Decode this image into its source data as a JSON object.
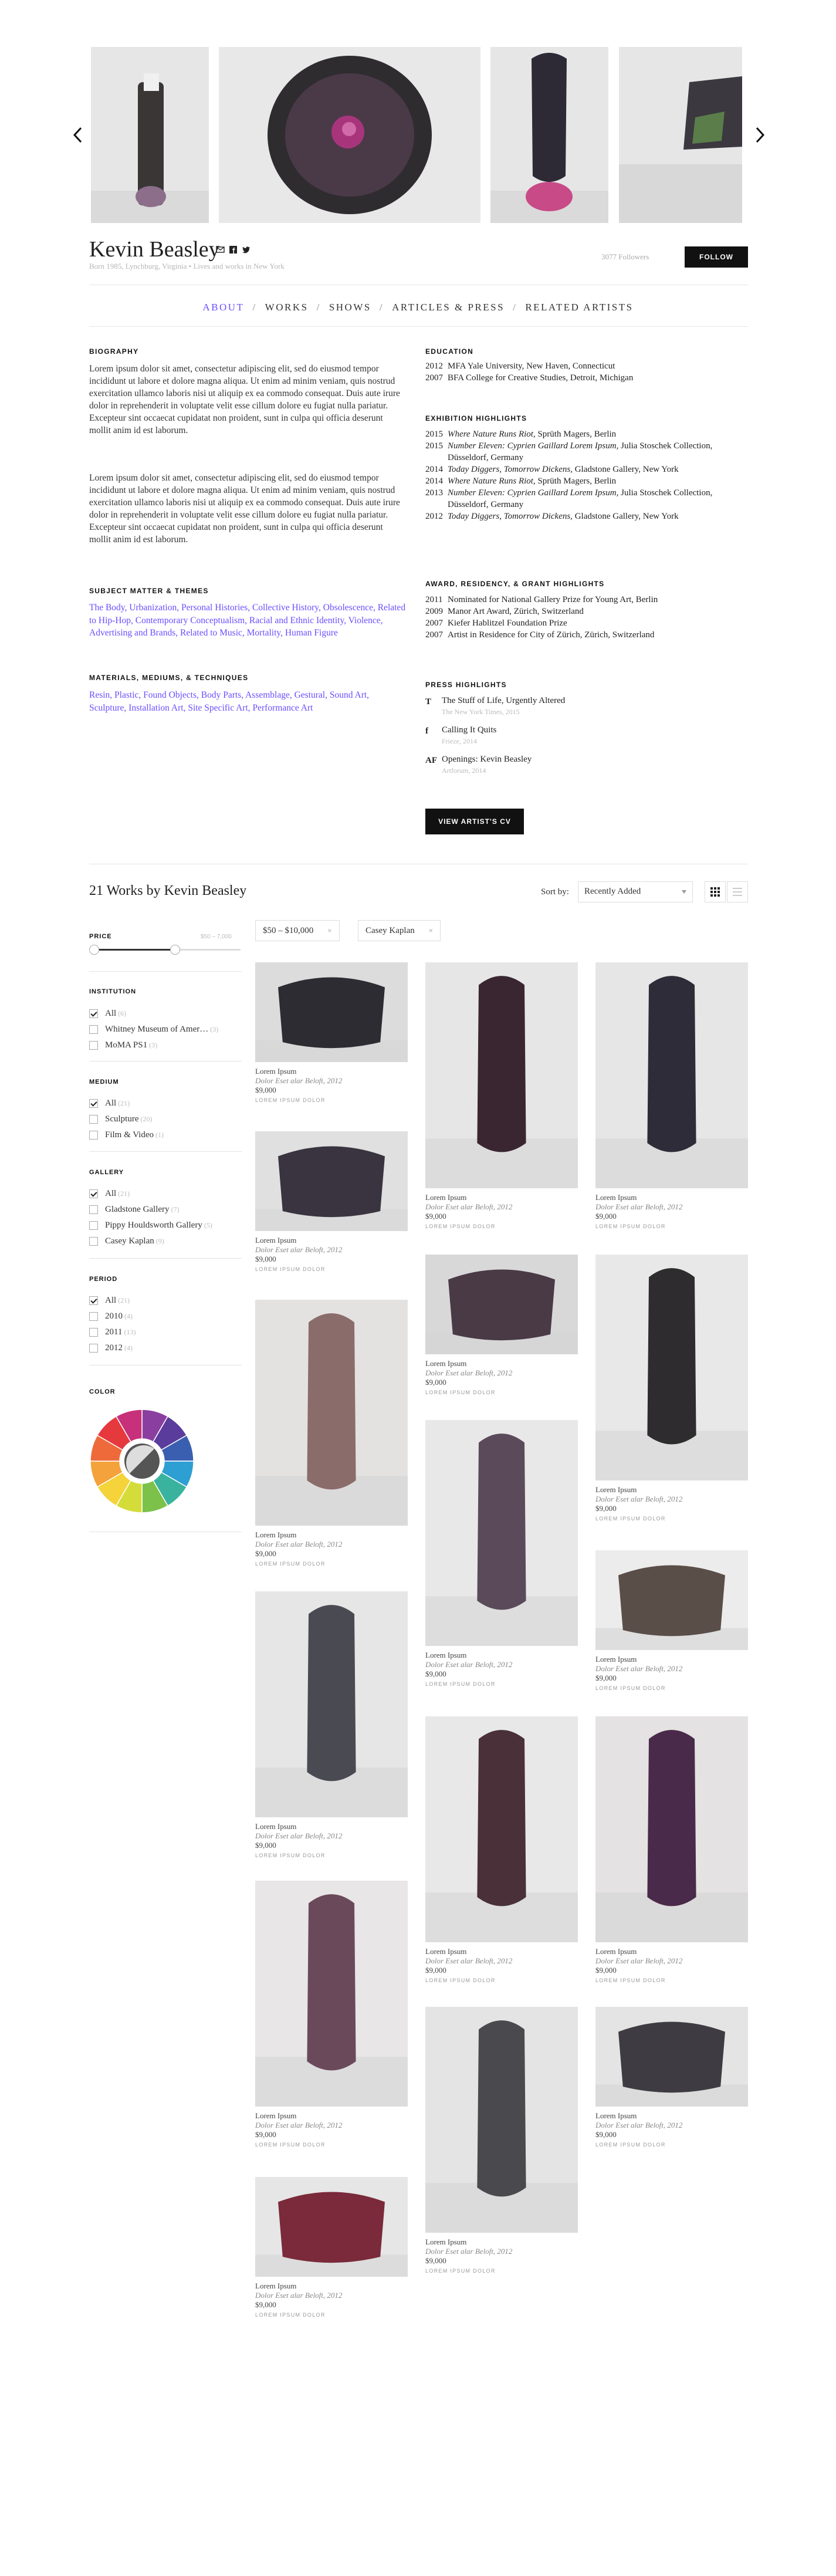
{
  "carousel": {
    "prev_icon": "chevron-left-icon",
    "next_icon": "chevron-right-icon"
  },
  "artist": {
    "name": "Kevin Beasley",
    "bio_line": "Born 1985, Lynchburg, Virginia • Lives and works in New York",
    "followers": "3077 Followers",
    "follow_label": "FOLLOW",
    "social_icons": [
      "email-icon",
      "facebook-icon",
      "twitter-icon"
    ]
  },
  "tabs": [
    "ABOUT",
    "WORKS",
    "SHOWS",
    "ARTICLES & PRESS",
    "RELATED ARTISTS"
  ],
  "about": {
    "biography_heading": "BIOGRAPHY",
    "bio_p1": "Lorem ipsum dolor sit amet, consectetur adipiscing elit, sed do eiusmod tempor incididunt ut labore et dolore magna aliqua. Ut enim ad minim veniam, quis nostrud exercitation ullamco laboris nisi ut aliquip ex ea commodo consequat. Duis aute irure dolor in reprehenderit in voluptate velit esse cillum dolore eu fugiat nulla pariatur. Excepteur sint occaecat cupidatat non proident, sunt in culpa qui officia deserunt mollit anim id est laborum.",
    "bio_p2": "Lorem ipsum dolor sit amet, consectetur adipiscing elit, sed do eiusmod tempor incididunt ut labore et dolore magna aliqua. Ut enim ad minim veniam, quis nostrud exercitation ullamco laboris nisi ut aliquip ex ea commodo consequat. Duis aute irure dolor in reprehenderit in voluptate velit esse cillum dolore eu fugiat nulla pariatur. Excepteur sint occaecat cupidatat non proident, sunt in culpa qui officia deserunt mollit anim id est laborum.",
    "subject_heading": "SUBJECT MATTER & THEMES",
    "subjects": "The Body, Urbanization, Personal Histories, Collective History, Obsolescence, Related to Hip-Hop, Contemporary Conceptualism, Racial and Ethnic Identity, Violence, Advertising and Brands, Related to Music, Mortality, Human Figure",
    "materials_heading": "MATERIALS, MEDIUMS, & TECHNIQUES",
    "materials": "Resin, Plastic, Found Objects, Body Parts, Assemblage, Gestural, Sound Art, Sculpture, Installation Art, Site Specific Art, Performance Art",
    "education_heading": "EDUCATION",
    "education": [
      {
        "year": "2012",
        "text": "MFA Yale University, New Haven, Connecticut"
      },
      {
        "year": "2007",
        "text": "BFA College for Creative Studies, Detroit, Michigan"
      }
    ],
    "exhibition_heading": "EXHIBITION HIGHLIGHTS",
    "exhibitions": [
      {
        "year": "2015",
        "title": "Where Nature Runs Riot,",
        "rest": " Sprüth Magers, Berlin"
      },
      {
        "year": "2015",
        "title": "Number Eleven: Cyprien Gaillard Lorem Ipsum,",
        "rest": " Julia Stoschek Collection, Düsseldorf, Germany"
      },
      {
        "year": "2014",
        "title": "Today Diggers, Tomorrow Dickens,",
        "rest": " Gladstone Gallery, New York"
      },
      {
        "year": "2014",
        "title": "Where Nature Runs Riot,",
        "rest": " Sprüth Magers, Berlin"
      },
      {
        "year": "2013",
        "title": "Number Eleven: Cyprien Gaillard Lorem Ipsum,",
        "rest": " Julia Stoschek Collection, Düsseldorf, Germany"
      },
      {
        "year": "2012",
        "title": "Today Diggers, Tomorrow Dickens,",
        "rest": " Gladstone Gallery, New York"
      }
    ],
    "award_heading": "AWARD, RESIDENCY, & GRANT HIGHLIGHTS",
    "awards": [
      {
        "year": "2011",
        "text": "Nominated for National Gallery Prize for Young Art, Berlin"
      },
      {
        "year": "2009",
        "text": "Manor Art Award, Zürich, Switzerland"
      },
      {
        "year": "2007",
        "text": "Kiefer Hablitzel Foundation Prize"
      },
      {
        "year": "2007",
        "text": "Artist in Residence for City of Zürich, Zürich, Switzerland"
      }
    ],
    "press_heading": "PRESS HIGHLIGHTS",
    "press": [
      {
        "icon": "T",
        "title": "The Stuff of Life, Urgently Altered",
        "source": "The New York Times, 2015"
      },
      {
        "icon": "f",
        "title": "Calling It Quits",
        "source": "Frieze, 2014"
      },
      {
        "icon": "AF",
        "title": "Openings: Kevin Beasley",
        "source": "Artforum, 2014"
      }
    ],
    "cv_label": "VIEW ARTIST'S CV"
  },
  "works_header": {
    "title": "21 Works by Kevin Beasley",
    "sort_label": "Sort by:",
    "sort_value": "Recently Added",
    "chips": [
      "$50 – $10,000",
      "Casey Kaplan"
    ],
    "chip_close": "×"
  },
  "filters": {
    "price_heading": "PRICE",
    "price_range": "$50 – 7,000",
    "price_level": [
      0.0,
      0.55
    ],
    "institution_heading": "INSTITUTION",
    "institution": [
      {
        "label": "All",
        "count": "(6)",
        "on": true
      },
      {
        "label": "Whitney Museum of Amer…",
        "count": "(3)",
        "on": false
      },
      {
        "label": "MoMA PS1",
        "count": "(3)",
        "on": false
      }
    ],
    "medium_heading": "MEDIUM",
    "medium": [
      {
        "label": "All",
        "count": "(21)",
        "on": true
      },
      {
        "label": "Sculpture",
        "count": "(20)",
        "on": false
      },
      {
        "label": "Film & Video",
        "count": "(1)",
        "on": false
      }
    ],
    "gallery_heading": "GALLERY",
    "gallery": [
      {
        "label": "All",
        "count": "(21)",
        "on": true
      },
      {
        "label": "Gladstone Gallery",
        "count": "(7)",
        "on": false
      },
      {
        "label": "Pippy Houldsworth Gallery",
        "count": "(5)",
        "on": false
      },
      {
        "label": "Casey Kaplan",
        "count": "(9)",
        "on": false
      }
    ],
    "period_heading": "PERIOD",
    "period": [
      {
        "label": "All",
        "count": "(21)",
        "on": true
      },
      {
        "label": "2010",
        "count": "(4)",
        "on": false
      },
      {
        "label": "2011",
        "count": "(13)",
        "on": false
      },
      {
        "label": "2012",
        "count": "(4)",
        "on": false
      }
    ],
    "color_heading": "COLOR",
    "color_wheel": [
      "#8a3fa0",
      "#5a3c9c",
      "#3a5fb0",
      "#2d9fd3",
      "#3ab39e",
      "#7cc24a",
      "#d4dc3a",
      "#f5d33a",
      "#f4a23b",
      "#ee6a3a",
      "#e5393e",
      "#c7317b"
    ]
  },
  "work_meta": {
    "title": "Lorem Ipsum",
    "subtitle": "Dolor Eset alar Beloft, 2012",
    "price": "$9,000",
    "gallery": "LOREM IPSUM DOLOR"
  }
}
